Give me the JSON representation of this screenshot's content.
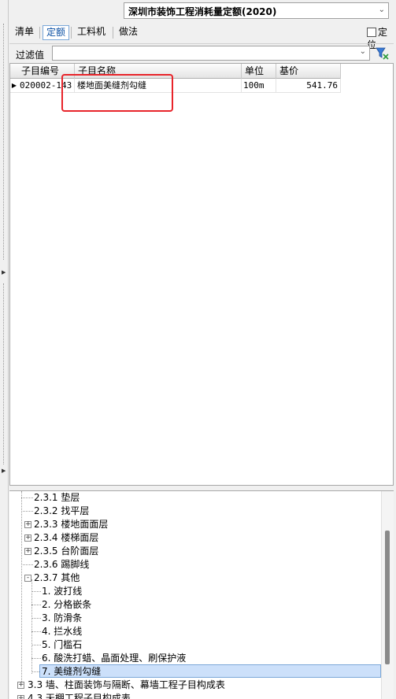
{
  "quota_select": {
    "value": "深圳市装饰工程消耗量定额(2020)"
  },
  "tabs": [
    {
      "label": "清单",
      "active": false
    },
    {
      "label": "定额",
      "active": true
    },
    {
      "label": "工料机",
      "active": false
    },
    {
      "label": "做法",
      "active": false
    }
  ],
  "locate": {
    "label": "定位",
    "checked": false
  },
  "filter": {
    "label": "过滤值",
    "value": ""
  },
  "grid": {
    "columns": [
      "子目编号",
      "子目名称",
      "单位",
      "基价"
    ],
    "rows": [
      {
        "code": "020002-143",
        "name": "楼地面美缝剂勾缝",
        "unit": "100m",
        "price": "541.76"
      }
    ]
  },
  "tree": {
    "nodes": [
      {
        "label": "2.3.1 垫层",
        "expander": ""
      },
      {
        "label": "2.3.2 找平层",
        "expander": ""
      },
      {
        "label": "2.3.3 楼地面面层",
        "expander": "+"
      },
      {
        "label": "2.3.4 楼梯面层",
        "expander": "+"
      },
      {
        "label": "2.3.5 台阶面层",
        "expander": "+"
      },
      {
        "label": "2.3.6 踢脚线",
        "expander": ""
      },
      {
        "label": "2.3.7 其他",
        "expander": "-"
      },
      {
        "label": "1. 波打线",
        "expander": ""
      },
      {
        "label": "2. 分格嵌条",
        "expander": ""
      },
      {
        "label": "3. 防滑条",
        "expander": ""
      },
      {
        "label": "4. 拦水线",
        "expander": ""
      },
      {
        "label": "5. 门槛石",
        "expander": ""
      },
      {
        "label": "6. 酸洗打蜡、晶面处理、刷保护液",
        "expander": ""
      },
      {
        "label": "7. 美缝剂勾缝",
        "expander": "",
        "selected": true
      },
      {
        "label": "3.3 墙、柱面装饰与隔断、幕墙工程子目构成表",
        "expander": "+"
      },
      {
        "label": "4.3 天棚工程子目构成表",
        "expander": "+"
      }
    ]
  }
}
